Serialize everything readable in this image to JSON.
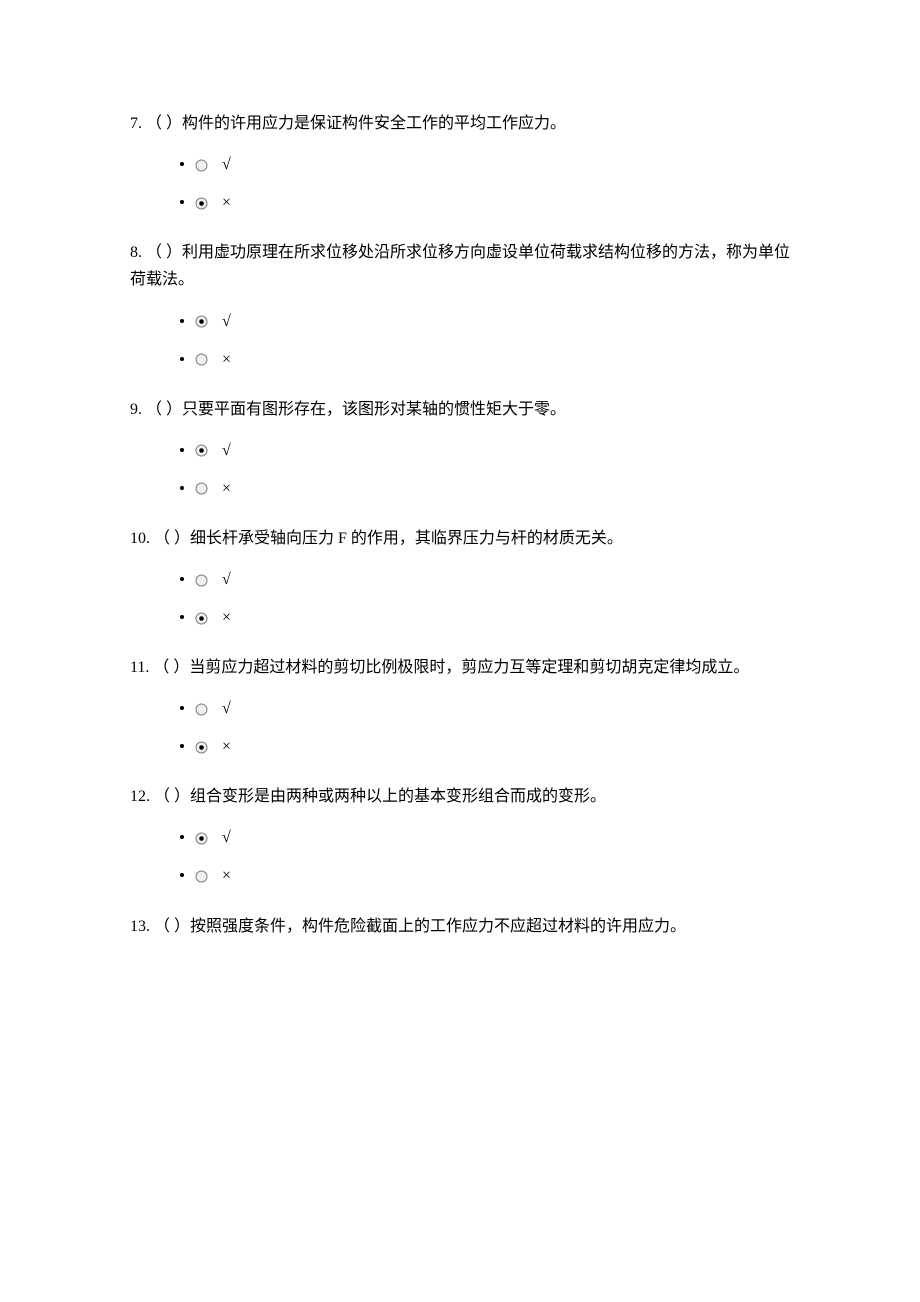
{
  "labels": {
    "true": "√",
    "false": "×"
  },
  "questions": [
    {
      "num": "7.",
      "text": "（ ）构件的许用应力是保证构件安全工作的平均工作应力。",
      "selected": 1
    },
    {
      "num": "8.",
      "text": "（ ）利用虚功原理在所求位移处沿所求位移方向虚设单位荷载求结构位移的方法，称为单位荷载法。",
      "selected": 0
    },
    {
      "num": "9.",
      "text": "（ ）只要平面有图形存在，该图形对某轴的惯性矩大于零。",
      "selected": 0
    },
    {
      "num": "10.",
      "text": "（ ）细长杆承受轴向压力 F 的作用，其临界压力与杆的材质无关。",
      "selected": 1
    },
    {
      "num": "11.",
      "text": "（ ）当剪应力超过材料的剪切比例极限时，剪应力互等定理和剪切胡克定律均成立。",
      "selected": 1
    },
    {
      "num": "12.",
      "text": "（ ）组合变形是由两种或两种以上的基本变形组合而成的变形。",
      "selected": 0
    },
    {
      "num": "13.",
      "text": "（ ）按照强度条件，构件危险截面上的工作应力不应超过材料的许用应力。",
      "selected": null
    }
  ]
}
